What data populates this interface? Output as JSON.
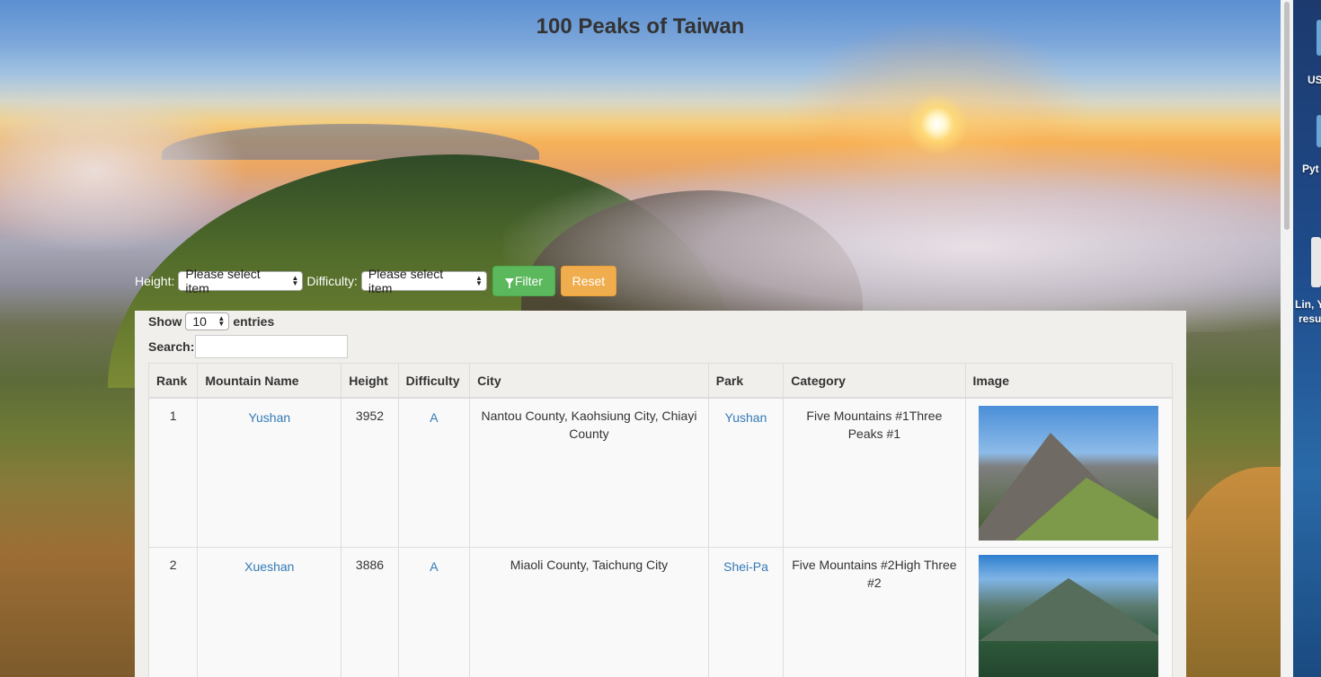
{
  "header": {
    "title": "100 Peaks of Taiwan"
  },
  "filters": {
    "height_label": "Height:",
    "height_value": "Please select item",
    "difficulty_label": "Difficulty:",
    "difficulty_value": "Please select item",
    "filter_label": "Filter",
    "reset_label": "Reset"
  },
  "table_controls": {
    "show_label": "Show",
    "entries_value": "10",
    "entries_label": "entries",
    "search_label": "Search:"
  },
  "table": {
    "columns": [
      "Rank",
      "Mountain Name",
      "Height",
      "Difficulty",
      "City",
      "Park",
      "Category",
      "Image"
    ],
    "rows": [
      {
        "rank": "1",
        "name": "Yushan",
        "height": "3952",
        "difficulty": "A",
        "city": "Nantou County, Kaohsiung City, Chiayi County",
        "park": "Yushan",
        "category": "Five Mountains #1Three Peaks #1"
      },
      {
        "rank": "2",
        "name": "Xueshan",
        "height": "3886",
        "difficulty": "A",
        "city": "Miaoli County, Taichung City",
        "park": "Shei-Pa",
        "category": "Five Mountains #2High Three #2"
      }
    ]
  },
  "desktop": {
    "labels": [
      "US",
      "Pyt",
      "Lin, Y",
      "resu"
    ]
  },
  "colors": {
    "link": "#337ab7",
    "filter_button": "#5cb85c",
    "reset_button": "#f0ad4e",
    "panel": "#f0efeb"
  }
}
